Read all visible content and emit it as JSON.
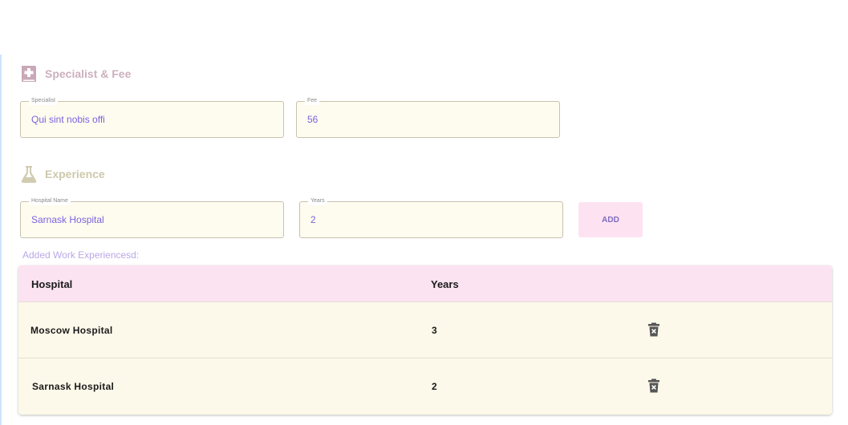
{
  "sections": {
    "specialist": {
      "title": "Specialist & Fee",
      "icon": "medical-book-icon"
    },
    "experience": {
      "title": "Experience",
      "icon": "flask-icon"
    }
  },
  "fields": {
    "specialist": {
      "label": "Specialist",
      "value": "Qui sint nobis offi"
    },
    "fee": {
      "label": "Fee",
      "value": "56"
    },
    "hospital_name": {
      "label": "Hospital Name",
      "value": "Sarnask Hospital"
    },
    "years": {
      "label": "Years",
      "value": "2"
    }
  },
  "add_button": {
    "label": "ADD"
  },
  "added_label": "Added Work Experiencesd:",
  "table": {
    "headers": [
      "Hospital",
      "Years"
    ],
    "rows": [
      {
        "hospital": "Moscow Hospital",
        "years": "3",
        "action_icon": "delete-icon"
      },
      {
        "hospital": "Sarnask Hospital",
        "years": "2",
        "action_icon": "delete-icon"
      }
    ]
  },
  "colors": {
    "accent_pink": "#fce3f1",
    "field_bg": "#fefbef",
    "input_text": "#7a63e0",
    "specialist_title": "#cdb0bd",
    "experience_title": "#cdc8ac"
  }
}
